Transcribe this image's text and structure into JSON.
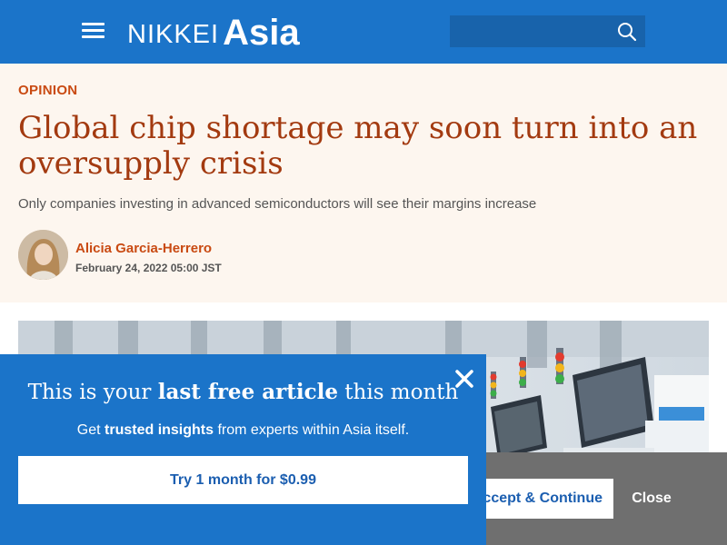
{
  "header": {
    "logo_nikkei": "NIKKEI",
    "logo_asia": "Asia",
    "search_placeholder": "",
    "background": "#1b74c9"
  },
  "article": {
    "section": "OPINION",
    "headline": "Global chip shortage may soon turn into an oversupply crisis",
    "subheadline": "Only companies investing in advanced semiconductors will see their margins increase",
    "author": "Alicia Garcia-Herrero",
    "date": "February 24, 2022 05:00 JST",
    "accent_color": "#c94a12"
  },
  "paywall": {
    "title_part1": "This is your ",
    "title_bold": "last free article",
    "title_part2": " this month",
    "text_part1": "Get ",
    "text_bold": "trusted insights",
    "text_part2": " from experts within Asia itself.",
    "cta": "Try 1 month for $0.99",
    "close_icon": "close-icon"
  },
  "cookie_bar": {
    "accept_label": "Accept & Continue",
    "close_label": "Close"
  },
  "icons": {
    "menu": "hamburger-menu-icon",
    "search": "search-icon"
  }
}
